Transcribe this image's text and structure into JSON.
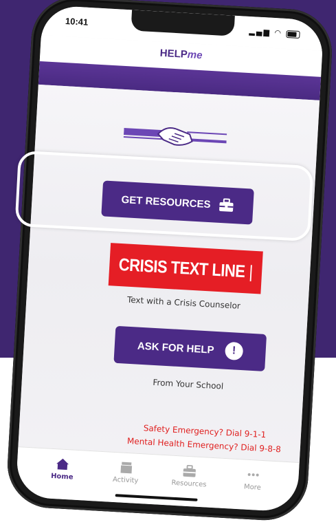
{
  "status_bar": {
    "time": "10:41"
  },
  "app": {
    "logo_main": "HELP",
    "logo_me": "me"
  },
  "buttons": {
    "get_resources": "GET RESOURCES",
    "ask_for_help": "ASK FOR HELP",
    "ask_icon": "!"
  },
  "crisis": {
    "label": "CRISIS TEXT LINE",
    "cursor": "|",
    "subtitle": "Text with a Crisis Counselor"
  },
  "ask_subtitle": "From Your School",
  "emergency": {
    "safety": "Safety Emergency? Dial 9-1-1",
    "mental": "Mental Health Emergency? Dial 9-8-8"
  },
  "tabbar": {
    "items": [
      {
        "label": "Home",
        "icon": "home-icon",
        "active": true
      },
      {
        "label": "Activity",
        "icon": "activity-icon",
        "active": false
      },
      {
        "label": "Resources",
        "icon": "toolbox-icon",
        "active": false
      },
      {
        "label": "More",
        "icon": "more-icon",
        "active": false
      }
    ]
  },
  "colors": {
    "brand_purple": "#4b2a86",
    "background_purple": "#3f2670",
    "crisis_red": "#e51e25",
    "emergency_red": "#e02020"
  }
}
